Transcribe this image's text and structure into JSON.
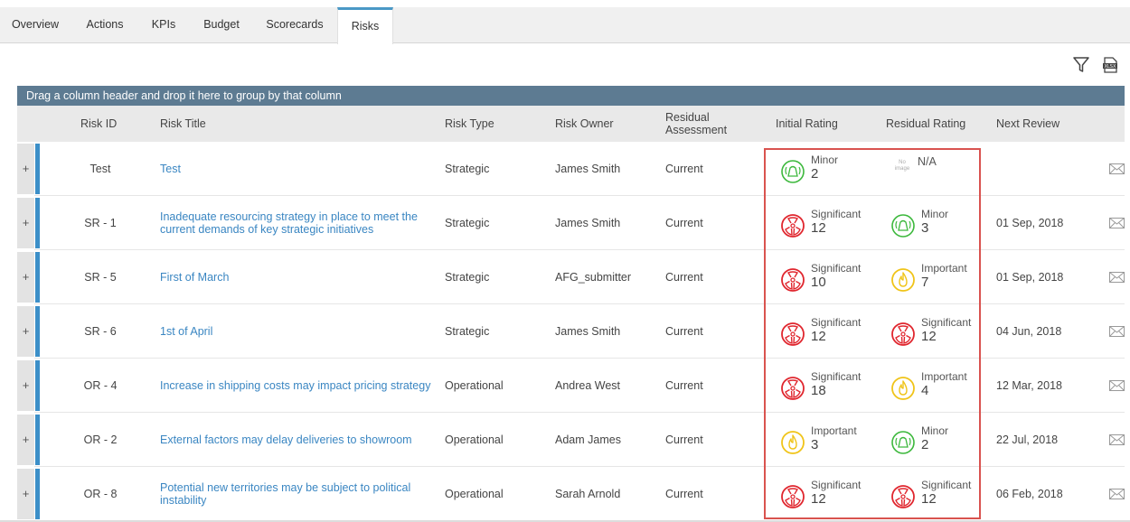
{
  "tabs": [
    {
      "label": "Overview"
    },
    {
      "label": "Actions"
    },
    {
      "label": "KPIs"
    },
    {
      "label": "Budget"
    },
    {
      "label": "Scorecards"
    },
    {
      "label": "Risks"
    }
  ],
  "active_tab": "Risks",
  "toolbar": {
    "filter_icon": "filter-icon",
    "export_icon": "xlsx-export-icon"
  },
  "group_bar": {
    "text": "Drag a column header and drop it here to group by that column"
  },
  "columns": {
    "risk_id": "Risk ID",
    "risk_title": "Risk Title",
    "risk_type": "Risk Type",
    "risk_owner": "Risk Owner",
    "residual_assessment_1": "Residual",
    "residual_assessment_2": "Assessment",
    "initial_rating": "Initial Rating",
    "residual_rating": "Residual Rating",
    "next_review": "Next Review"
  },
  "rating_colors": {
    "Minor": "#3cb83c",
    "Significant": "#e0262e",
    "Important": "#f0c419"
  },
  "rows": [
    {
      "expander": "+",
      "id": "Test",
      "title_1": "Test",
      "title_2": "",
      "type": "Strategic",
      "owner": "James Smith",
      "residual": "Current",
      "initial": {
        "label": "Minor",
        "score": "2",
        "icon": "minor-icon"
      },
      "residual_rating": {
        "label": "N/A",
        "score": "",
        "icon": "no-image",
        "noimg_1": "No",
        "noimg_2": "image"
      },
      "next_review": ""
    },
    {
      "expander": "+",
      "id": "SR - 1",
      "title_1": "Inadequate resourcing strategy in place to meet the",
      "title_2": "current demands of key strategic initiatives",
      "type": "Strategic",
      "owner": "James Smith",
      "residual": "Current",
      "initial": {
        "label": "Significant",
        "score": "12",
        "icon": "significant-icon"
      },
      "residual_rating": {
        "label": "Minor",
        "score": "3",
        "icon": "minor-icon"
      },
      "next_review": "01 Sep, 2018"
    },
    {
      "expander": "+",
      "id": "SR - 5",
      "title_1": "First of March",
      "title_2": "",
      "type": "Strategic",
      "owner": "AFG_submitter",
      "residual": "Current",
      "initial": {
        "label": "Significant",
        "score": "10",
        "icon": "significant-icon"
      },
      "residual_rating": {
        "label": "Important",
        "score": "7",
        "icon": "important-icon"
      },
      "next_review": "01 Sep, 2018"
    },
    {
      "expander": "+",
      "id": "SR - 6",
      "title_1": "1st of April",
      "title_2": "",
      "type": "Strategic",
      "owner": "James Smith",
      "residual": "Current",
      "initial": {
        "label": "Significant",
        "score": "12",
        "icon": "significant-icon"
      },
      "residual_rating": {
        "label": "Significant",
        "score": "12",
        "icon": "significant-icon"
      },
      "next_review": "04 Jun, 2018"
    },
    {
      "expander": "+",
      "id": "OR - 4",
      "title_1": "Increase in shipping costs may impact pricing strategy",
      "title_2": "",
      "type": "Operational",
      "owner": "Andrea West",
      "residual": "Current",
      "initial": {
        "label": "Significant",
        "score": "18",
        "icon": "significant-icon"
      },
      "residual_rating": {
        "label": "Important",
        "score": "4",
        "icon": "important-icon"
      },
      "next_review": "12 Mar, 2018"
    },
    {
      "expander": "+",
      "id": "OR - 2",
      "title_1": "External factors may delay deliveries to showroom",
      "title_2": "",
      "type": "Operational",
      "owner": "Adam James",
      "residual": "Current",
      "initial": {
        "label": "Important",
        "score": "3",
        "icon": "important-icon"
      },
      "residual_rating": {
        "label": "Minor",
        "score": "2",
        "icon": "minor-icon"
      },
      "next_review": "22 Jul, 2018"
    },
    {
      "expander": "+",
      "id": "OR - 8",
      "title_1": "Potential new territories may be subject to political",
      "title_2": "instability",
      "type": "Operational",
      "owner": "Sarah Arnold",
      "residual": "Current",
      "initial": {
        "label": "Significant",
        "score": "12",
        "icon": "significant-icon"
      },
      "residual_rating": {
        "label": "Significant",
        "score": "12",
        "icon": "significant-icon"
      },
      "next_review": "06 Feb, 2018"
    }
  ]
}
